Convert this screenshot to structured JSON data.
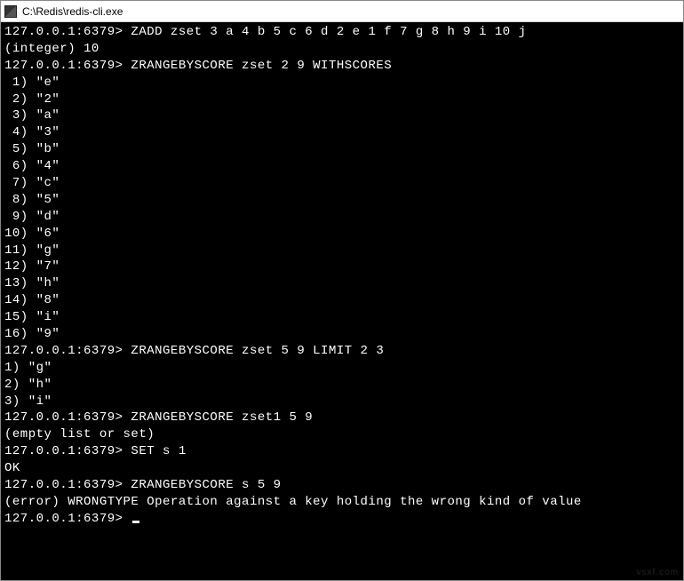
{
  "window": {
    "title": "C:\\Redis\\redis-cli.exe"
  },
  "terminal": {
    "prompt": "127.0.0.1:6379>",
    "lines": [
      {
        "type": "cmd",
        "text": "127.0.0.1:6379> ZADD zset 3 a 4 b 5 c 6 d 2 e 1 f 7 g 8 h 9 i 10 j"
      },
      {
        "type": "out",
        "text": "(integer) 10"
      },
      {
        "type": "cmd",
        "text": "127.0.0.1:6379> ZRANGEBYSCORE zset 2 9 WITHSCORES"
      },
      {
        "type": "out",
        "text": " 1) \"e\""
      },
      {
        "type": "out",
        "text": " 2) \"2\""
      },
      {
        "type": "out",
        "text": " 3) \"a\""
      },
      {
        "type": "out",
        "text": " 4) \"3\""
      },
      {
        "type": "out",
        "text": " 5) \"b\""
      },
      {
        "type": "out",
        "text": " 6) \"4\""
      },
      {
        "type": "out",
        "text": " 7) \"c\""
      },
      {
        "type": "out",
        "text": " 8) \"5\""
      },
      {
        "type": "out",
        "text": " 9) \"d\""
      },
      {
        "type": "out",
        "text": "10) \"6\""
      },
      {
        "type": "out",
        "text": "11) \"g\""
      },
      {
        "type": "out",
        "text": "12) \"7\""
      },
      {
        "type": "out",
        "text": "13) \"h\""
      },
      {
        "type": "out",
        "text": "14) \"8\""
      },
      {
        "type": "out",
        "text": "15) \"i\""
      },
      {
        "type": "out",
        "text": "16) \"9\""
      },
      {
        "type": "cmd",
        "text": "127.0.0.1:6379> ZRANGEBYSCORE zset 5 9 LIMIT 2 3"
      },
      {
        "type": "out",
        "text": "1) \"g\""
      },
      {
        "type": "out",
        "text": "2) \"h\""
      },
      {
        "type": "out",
        "text": "3) \"i\""
      },
      {
        "type": "cmd",
        "text": "127.0.0.1:6379> ZRANGEBYSCORE zset1 5 9"
      },
      {
        "type": "out",
        "text": "(empty list or set)"
      },
      {
        "type": "cmd",
        "text": "127.0.0.1:6379> SET s 1"
      },
      {
        "type": "out",
        "text": "OK"
      },
      {
        "type": "cmd",
        "text": "127.0.0.1:6379> ZRANGEBYSCORE s 5 9"
      },
      {
        "type": "out",
        "text": "(error) WRONGTYPE Operation against a key holding the wrong kind of value"
      }
    ],
    "current_prompt": "127.0.0.1:6379> "
  },
  "watermark": "vsxf.com"
}
